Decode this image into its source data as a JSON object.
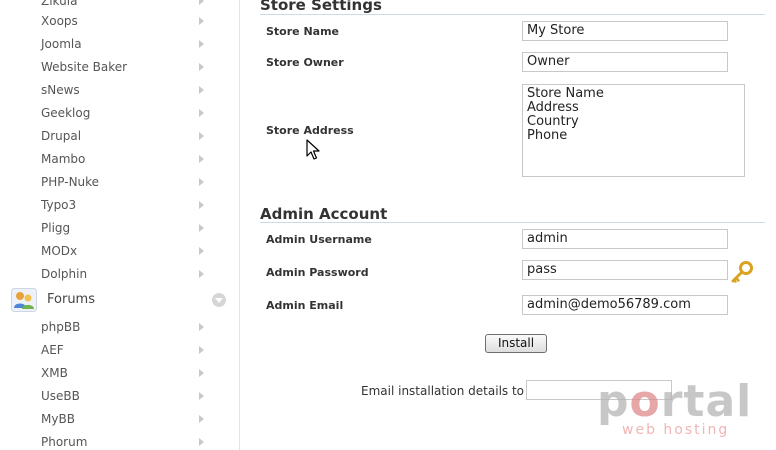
{
  "sidebar": {
    "items_top": [
      {
        "label": "Zikula"
      },
      {
        "label": "Xoops"
      },
      {
        "label": "Joomla"
      },
      {
        "label": "Website Baker"
      },
      {
        "label": "sNews"
      },
      {
        "label": "Geeklog"
      },
      {
        "label": "Drupal"
      },
      {
        "label": "Mambo"
      },
      {
        "label": "PHP-Nuke"
      },
      {
        "label": "Typo3"
      },
      {
        "label": "Pligg"
      },
      {
        "label": "MODx"
      },
      {
        "label": "Dolphin"
      }
    ],
    "category": {
      "label": "Forums",
      "icon": "forums-users-icon"
    },
    "items_forums": [
      {
        "label": "phpBB"
      },
      {
        "label": "AEF"
      },
      {
        "label": "XMB"
      },
      {
        "label": "UseBB"
      },
      {
        "label": "MyBB"
      },
      {
        "label": "Phorum"
      }
    ]
  },
  "store_settings": {
    "title": "Store Settings",
    "store_name": {
      "label": "Store Name",
      "value": "My Store"
    },
    "store_owner": {
      "label": "Store Owner",
      "value": "Owner"
    },
    "store_address": {
      "label": "Store Address",
      "lines": [
        "Store Name",
        "Address",
        "Country",
        "Phone"
      ]
    }
  },
  "admin_account": {
    "title": "Admin Account",
    "username": {
      "label": "Admin Username",
      "value": "admin"
    },
    "password": {
      "label": "Admin Password",
      "value": "pass"
    },
    "email": {
      "label": "Admin Email",
      "value": "admin@demo56789.com"
    }
  },
  "install_button": {
    "label": "Install"
  },
  "email_details": {
    "label": "Email installation details to :",
    "value": ""
  },
  "logo": {
    "main_a": "p",
    "main_accent": "o",
    "main_b": "rtal",
    "sub": "web hosting"
  },
  "colors": {
    "section_rule": "#cfd8e6",
    "logo_grey": "#b5b5b5",
    "logo_red": "#e08a8a",
    "key_gold": "#d9a320"
  }
}
